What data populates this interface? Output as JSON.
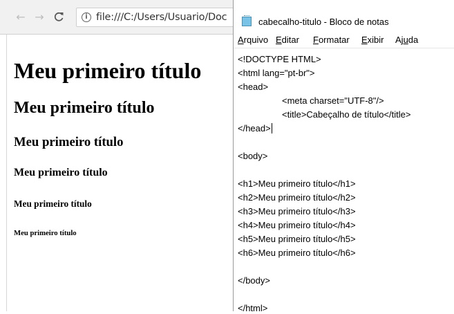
{
  "browser": {
    "nav": {
      "back_icon": "←",
      "forward_icon": "→",
      "reload_icon": "C"
    },
    "address": {
      "info_icon": "i",
      "url": "file:///C:/Users/Usuario/Doc"
    },
    "page": {
      "h1": "Meu primeiro título",
      "h2": "Meu primeiro título",
      "h3": "Meu primeiro título",
      "h4": "Meu primeiro título",
      "h5": "Meu primeiro título",
      "h6": "Meu primeiro título"
    }
  },
  "notepad": {
    "title": "cabecalho-titulo - Bloco de notas",
    "menu": {
      "arquivo": {
        "acc": "A",
        "rest": "rquivo"
      },
      "editar": {
        "acc": "E",
        "rest": "ditar"
      },
      "formatar": {
        "acc": "F",
        "rest": "ormatar"
      },
      "exibir": {
        "acc": "E",
        "rest": "xibir"
      },
      "ajuda": {
        "pre": "Aj",
        "acc": "u",
        "rest": "da"
      }
    },
    "lines": [
      "<!DOCTYPE HTML>",
      "<html lang=\"pt-br\">",
      "<head>",
      "<meta charset=\"UTF-8\"/>",
      "<title>Cabeçalho de título</title>",
      "</head>",
      "<body>",
      "<h1>Meu primeiro título</h1>",
      "<h2>Meu primeiro título</h2>",
      "<h3>Meu primeiro título</h3>",
      "<h4>Meu primeiro título</h4>",
      "<h5>Meu primeiro título</h5>",
      "<h6>Meu primeiro título</h6>",
      "</body>",
      "</html>"
    ]
  }
}
